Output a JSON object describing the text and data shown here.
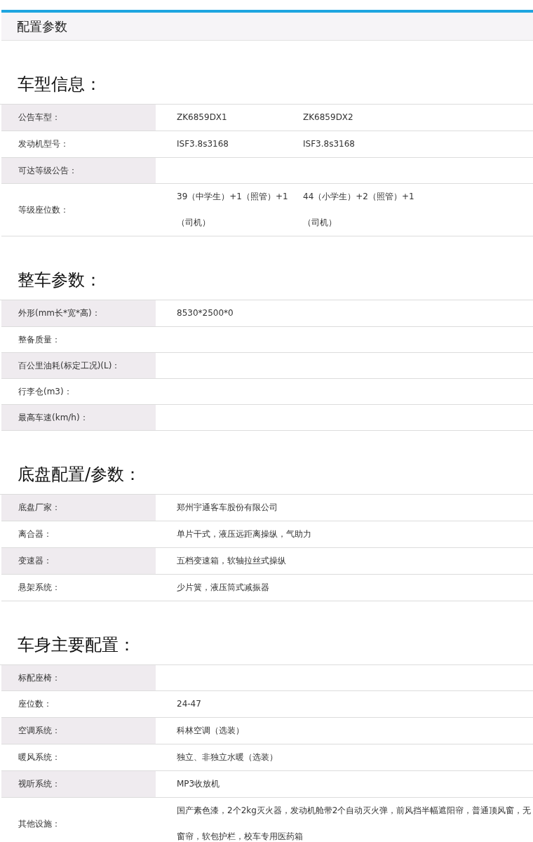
{
  "header": {
    "title": "配置参数"
  },
  "sections": [
    {
      "title": "车型信息：",
      "rows": [
        {
          "label": "公告车型：",
          "values": [
            "ZK6859DX1",
            "ZK6859DX2"
          ]
        },
        {
          "label": "发动机型号：",
          "values": [
            "ISF3.8s3168",
            "ISF3.8s3168"
          ]
        },
        {
          "label": "可达等级公告：",
          "values": []
        },
        {
          "label": "等级座位数：",
          "values": [
            "39（中学生）+1（照管）+1（司机）",
            "44（小学生）+2（照管）+1（司机）"
          ]
        }
      ]
    },
    {
      "title": "整车参数：",
      "rows": [
        {
          "label": "外形(mm长*宽*高)：",
          "values": [
            "8530*2500*0"
          ]
        },
        {
          "label": "整备质量：",
          "values": []
        },
        {
          "label": "百公里油耗(标定工况)(L)：",
          "values": []
        },
        {
          "label": "行李仓(m3)：",
          "values": []
        },
        {
          "label": "最高车速(km/h)：",
          "values": []
        }
      ]
    },
    {
      "title": "底盘配置/参数：",
      "rows": [
        {
          "label": "底盘厂家：",
          "values": [
            "郑州宇通客车股份有限公司"
          ]
        },
        {
          "label": "离合器：",
          "values": [
            "单片干式，液压远距离操纵，气助力"
          ]
        },
        {
          "label": "变速器：",
          "values": [
            "五档变速箱，软轴拉丝式操纵"
          ]
        },
        {
          "label": "悬架系统：",
          "values": [
            "少片簧，液压筒式减振器"
          ]
        }
      ]
    },
    {
      "title": "车身主要配置：",
      "rows": [
        {
          "label": "标配座椅：",
          "values": []
        },
        {
          "label": "座位数：",
          "values": [
            "24-47"
          ]
        },
        {
          "label": "空调系统：",
          "values": [
            "科林空调（选装）"
          ]
        },
        {
          "label": "暖风系统：",
          "values": [
            "独立、非独立水暖（选装）"
          ]
        },
        {
          "label": "视听系统：",
          "values": [
            "MP3收放机"
          ]
        },
        {
          "label": "其他设施：",
          "values": [
            "国产素色漆，2个2kg灭火器，发动机舱带2个自动灭火弹，前风挡半幅遮阳帘，普通顶风窗，无窗帘，软包护栏，校车专用医药箱"
          ]
        }
      ]
    }
  ]
}
